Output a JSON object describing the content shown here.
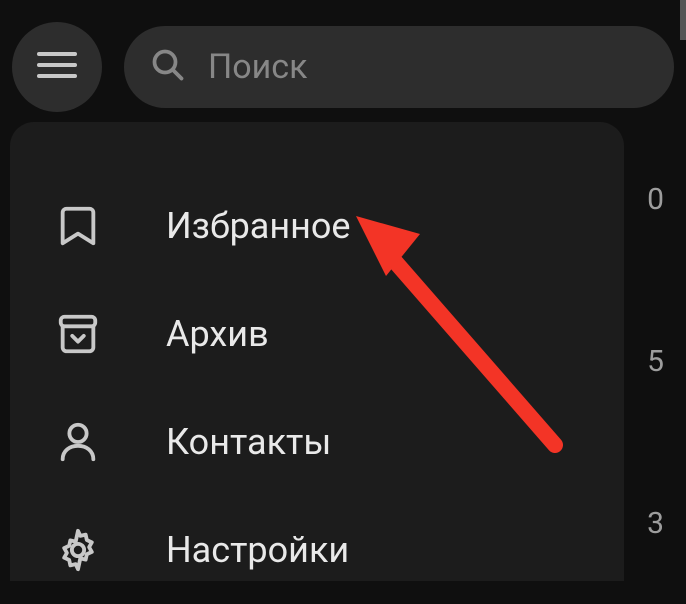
{
  "search": {
    "placeholder": "Поиск"
  },
  "menu": {
    "items": [
      {
        "label": "Избранное"
      },
      {
        "label": "Архив"
      },
      {
        "label": "Контакты"
      },
      {
        "label": "Настройки"
      }
    ]
  },
  "background_badges": [
    "0",
    "5",
    "3"
  ],
  "annotation": {
    "arrow_color": "#f33426"
  }
}
